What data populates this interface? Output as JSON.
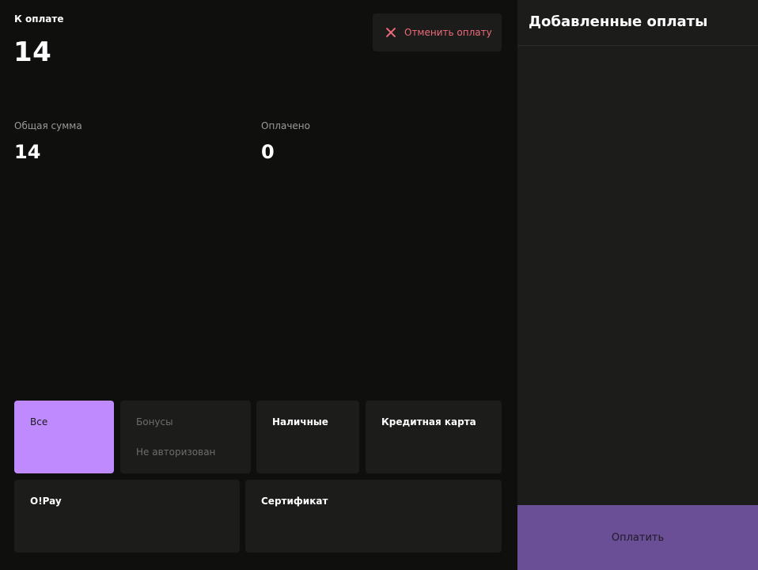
{
  "due": {
    "label": "К оплате",
    "value": "14"
  },
  "cancel": {
    "label": "Отменить оплату",
    "icon": "close-icon",
    "color": "#ef6a7a"
  },
  "summary": {
    "total": {
      "label": "Общая сумма",
      "value": "14"
    },
    "paid": {
      "label": "Оплачено",
      "value": "0"
    }
  },
  "methods": [
    {
      "label": "Все",
      "state": "selected"
    },
    {
      "label": "Бонусы",
      "sub": "Не авторизован",
      "state": "disabled"
    },
    {
      "label": "Наличные"
    },
    {
      "label": "Кредитная карта"
    },
    {
      "label": "O!Pay"
    },
    {
      "label": "Сертификат"
    }
  ],
  "payments_panel": {
    "title": "Добавленные оплаты"
  },
  "pay_button": {
    "label": "Оплатить"
  },
  "colors": {
    "accent": "#c08aff",
    "pay_button": "#6b4f96",
    "background": "#0f0f0e",
    "tile": "#1c1c1b"
  }
}
